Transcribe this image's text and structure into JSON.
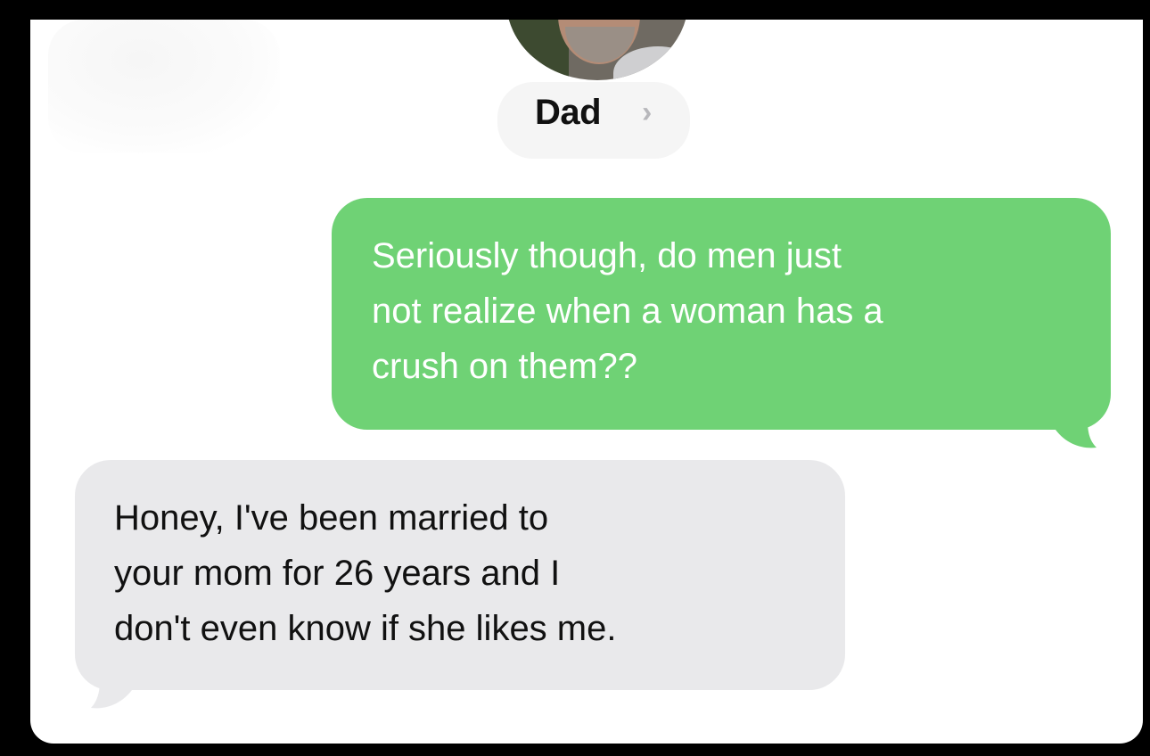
{
  "conversation": {
    "contact_name": "Dad",
    "contact_chevron": "›"
  },
  "messages": [
    {
      "direction": "outgoing",
      "lines": [
        "Seriously though, do men just",
        "not realize when a woman has a",
        "crush on them??"
      ]
    },
    {
      "direction": "incoming",
      "lines": [
        "Honey, I've been married to",
        "your mom for 26 years and I",
        "don't even know if she likes me."
      ]
    }
  ],
  "colors": {
    "outgoing_bubble": "#6fd275",
    "incoming_bubble": "#e9e9eb",
    "outgoing_text": "#ffffff",
    "incoming_text": "#111111"
  }
}
